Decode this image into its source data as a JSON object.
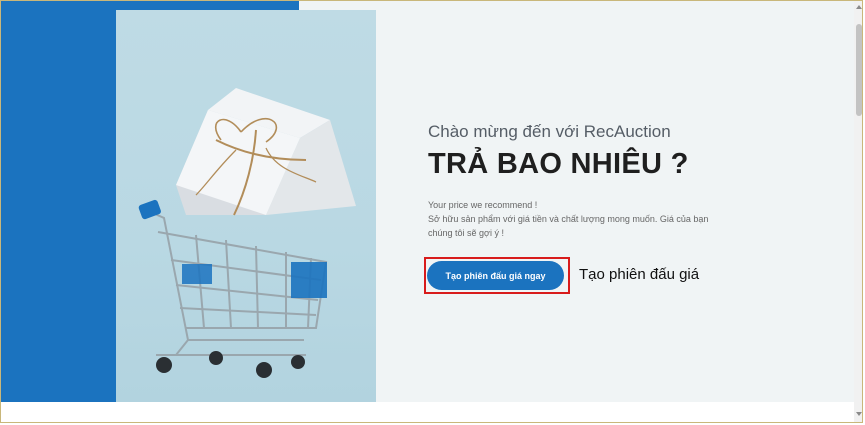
{
  "hero": {
    "welcome": "Chào mừng đến với RecAuction",
    "headline": "TRẢ BAO NHIÊU ?",
    "description_lines": [
      "Your price we recommend !",
      "Sở hữu sản phẩm với giá tiền và chất lượng mong muốn. Giá của bạn",
      "chúng tôi sẽ gợi ý !"
    ],
    "cta_label": "Tạo phiên đấu giá ngay"
  },
  "annotation": {
    "callout": "Tạo phiên đấu giá",
    "highlight_color": "#d81b1b"
  },
  "photo": {
    "zoom_icon": "focus-zoom-icon"
  },
  "colors": {
    "brand": "#1b73bf",
    "background": "#f0f4f5"
  }
}
